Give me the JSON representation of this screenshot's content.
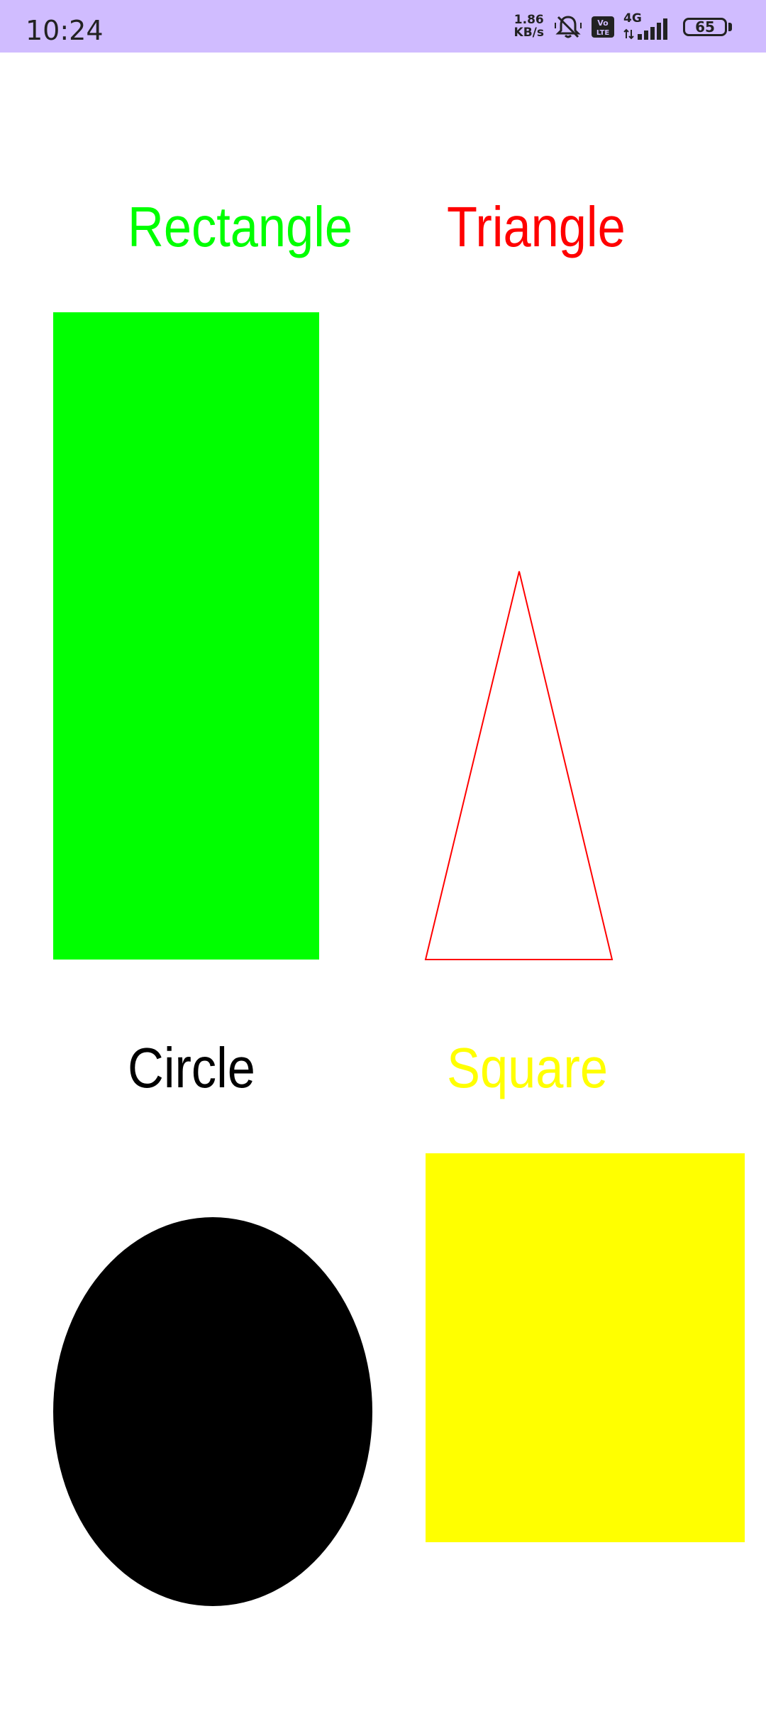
{
  "status_bar": {
    "time": "10:24",
    "net_speed_value": "1.86",
    "net_speed_unit": "KB/s",
    "network_type": "4G",
    "battery_level": "65",
    "icons": [
      "mute-icon",
      "volte-icon",
      "signal-icon",
      "battery-icon"
    ]
  },
  "shapes": {
    "rectangle": {
      "label": "Rectangle",
      "color": "#00ff00"
    },
    "triangle": {
      "label": "Triangle",
      "color": "#ff0000"
    },
    "circle": {
      "label": "Circle",
      "color": "#000000"
    },
    "square": {
      "label": "Square",
      "color": "#ffff00"
    }
  }
}
